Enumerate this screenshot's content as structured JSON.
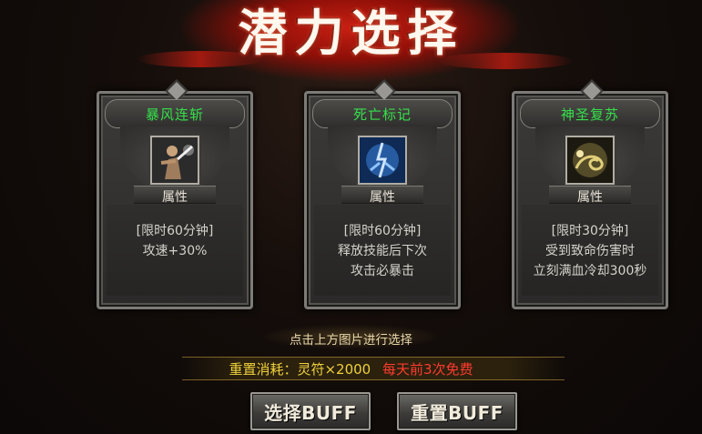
{
  "title": "潜力选择",
  "cards": [
    {
      "name": "暴风连斩",
      "attr_label": "属性",
      "icon": "warrior-slash-icon",
      "desc": [
        "[限时60分钟]",
        "攻速+30%"
      ]
    },
    {
      "name": "死亡标记",
      "attr_label": "属性",
      "icon": "lightning-mage-icon",
      "desc": [
        "[限时60分钟]",
        "释放技能后下次",
        "攻击必暴击"
      ]
    },
    {
      "name": "神圣复苏",
      "attr_label": "属性",
      "icon": "golden-serpent-icon",
      "desc": [
        "[限时30分钟]",
        "受到致命伤害时",
        "立刻满血冷却300秒"
      ]
    }
  ],
  "hint": "点击上方图片进行选择",
  "cost": {
    "label": "重置消耗：灵符×2000",
    "free_note": "每天前3次免费"
  },
  "buttons": {
    "select": "选择BUFF",
    "reset": "重置BUFF"
  },
  "colors": {
    "card_title": "#35e04b",
    "cost_label": "#f0d13b",
    "free_note": "#ff3b2f",
    "banner": "#c81f12"
  }
}
